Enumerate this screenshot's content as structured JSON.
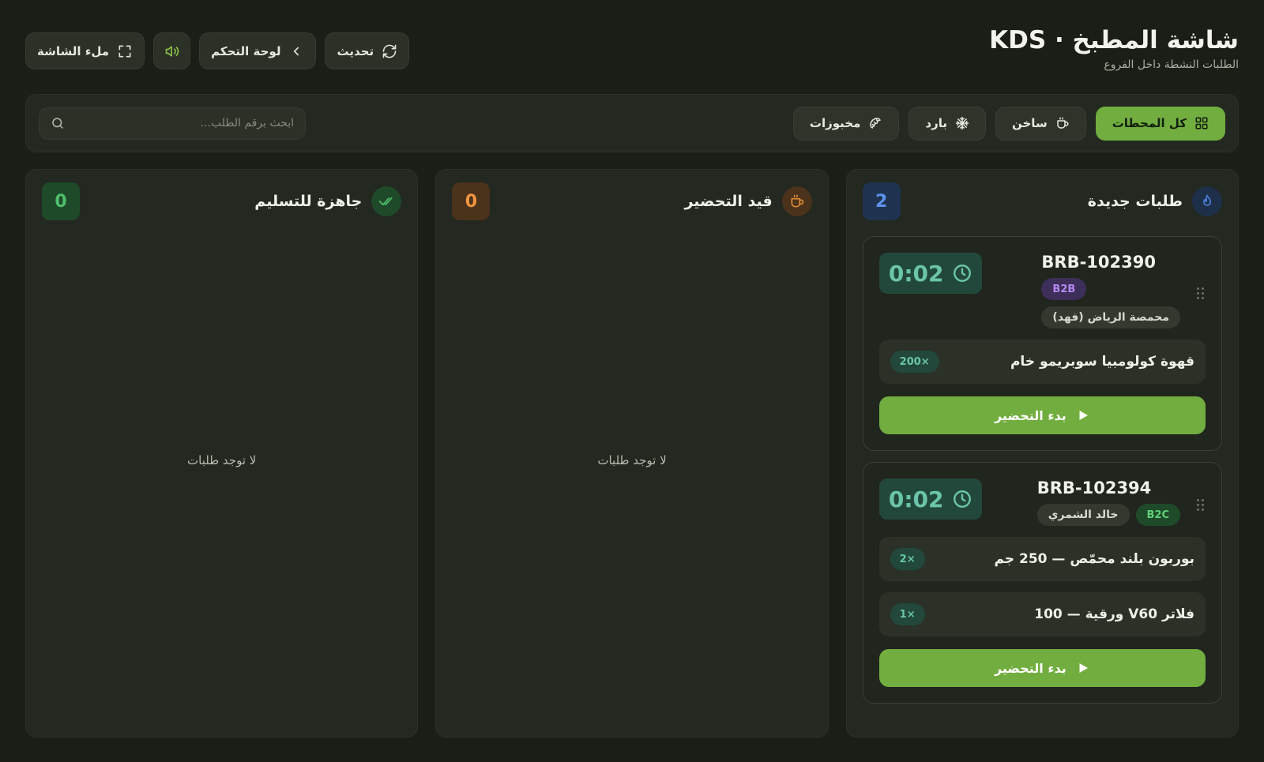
{
  "header": {
    "title": "شاشة المطبخ · KDS",
    "subtitle": "الطلبات النشطة داخل الفروع",
    "refresh_label": "تحديث",
    "dashboard_label": "لوحة التحكم",
    "fullscreen_label": "ملء الشاشة"
  },
  "filters": {
    "all": "كل المحطات",
    "hot": "ساخن",
    "cold": "بارد",
    "bakery": "مخبوزات",
    "search_placeholder": "ابحث برقم الطلب..."
  },
  "columns": {
    "new": {
      "title": "طلبات جديدة",
      "count": "2",
      "orders": [
        {
          "id": "BRB-102390",
          "type": "B2B",
          "customer": "محمصة الرياض (فهد)",
          "timer": "0:02",
          "items": [
            {
              "name": "قهوة كولومبيا سوبريمو خام",
              "qty": "200×"
            }
          ],
          "action": "بدء التحضير"
        },
        {
          "id": "BRB-102394",
          "type": "B2C",
          "customer": "خالد الشمري",
          "timer": "0:02",
          "items": [
            {
              "name": "بوربون بلند محمّص — 250 جم",
              "qty": "2×"
            },
            {
              "name": "فلاتر V60 ورقية — 100",
              "qty": "1×"
            }
          ],
          "action": "بدء التحضير"
        }
      ]
    },
    "preparing": {
      "title": "قيد التحضير",
      "count": "0",
      "empty": "لا توجد طلبات"
    },
    "ready": {
      "title": "جاهزة للتسليم",
      "count": "0",
      "empty": "لا توجد طلبات"
    }
  },
  "colors": {
    "accent": "#71ad3f",
    "timer": "#6bc5a9",
    "new": "#4a7fd8",
    "preparing": "#e08a3a",
    "ready": "#4fc06a"
  }
}
